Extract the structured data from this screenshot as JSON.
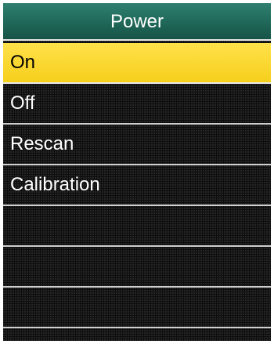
{
  "header": {
    "title": "Power"
  },
  "menu": {
    "items": [
      {
        "label": "On",
        "selected": true
      },
      {
        "label": "Off",
        "selected": false
      },
      {
        "label": "Rescan",
        "selected": false
      },
      {
        "label": "Calibration",
        "selected": false
      }
    ]
  },
  "colors": {
    "header_bg": "#1f6758",
    "selected_bg": "#f6cf1c",
    "screen_bg": "#0d0d0d",
    "divider": "#cfcfcf",
    "text": "#ffffff",
    "selected_text": "#000000"
  }
}
